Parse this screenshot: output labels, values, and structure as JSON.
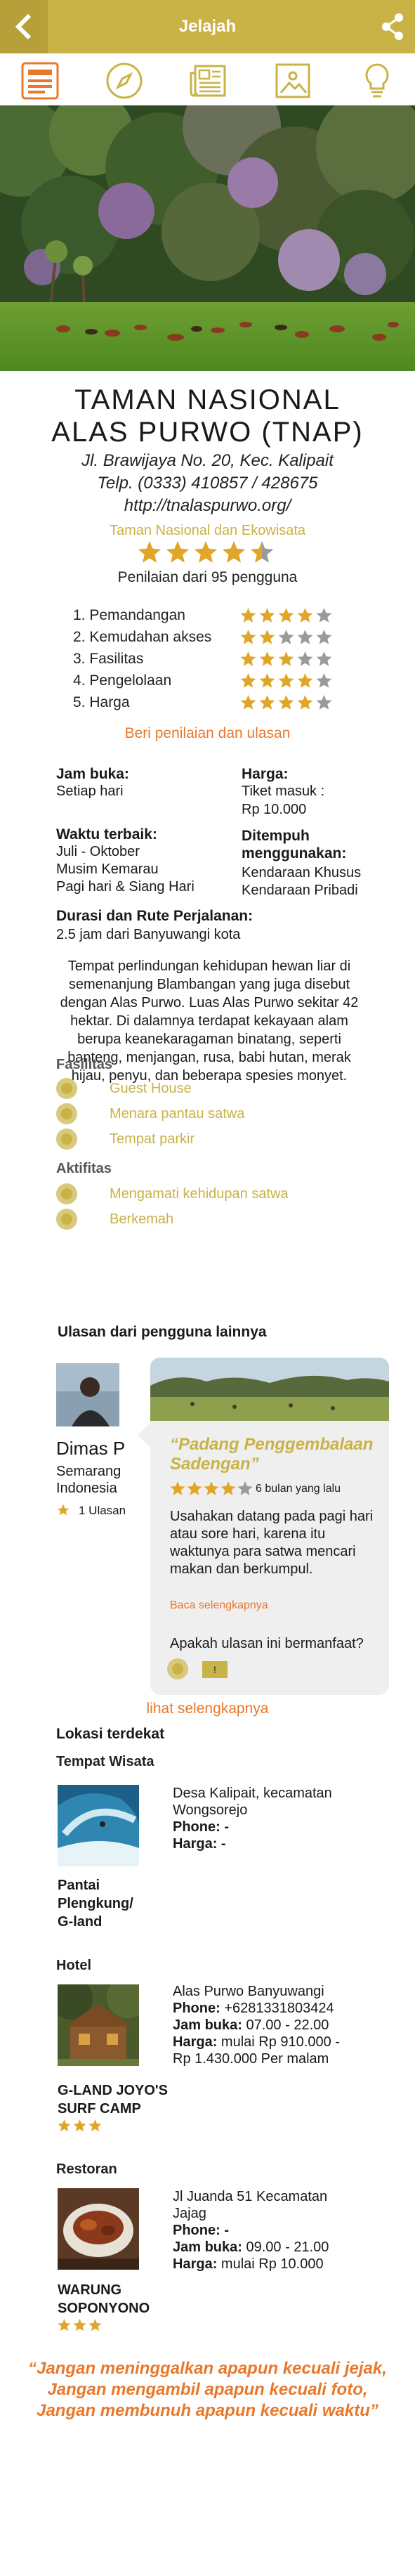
{
  "app": {
    "title": "Jelajah",
    "accent_color": "#c9b246",
    "link_color": "#e8782c"
  },
  "tabs": [
    {
      "icon": "document-icon"
    },
    {
      "icon": "compass-icon"
    },
    {
      "icon": "newspaper-icon"
    },
    {
      "icon": "image-icon"
    },
    {
      "icon": "lightbulb-icon"
    }
  ],
  "place": {
    "name_line1": "TAMAN NASIONAL",
    "name_line2": "ALAS PURWO (TNAP)",
    "address": "Jl. Brawijaya No. 20, Kec. Kalipait",
    "phone": "Telp. (0333) 410857 / 428675",
    "website": "http://tnalaspurwo.org/",
    "category": "Taman Nasional dan Ekowisata",
    "rating": 4.5,
    "rating_count_text": "Penilaian dari 95 pengguna"
  },
  "criteria": [
    {
      "label": "1. Pemandangan",
      "stars": 4
    },
    {
      "label": "2. Kemudahan akses",
      "stars": 2
    },
    {
      "label": "3. Fasilitas",
      "stars": 3
    },
    {
      "label": "4. Pengelolaan",
      "stars": 4
    },
    {
      "label": "5. Harga",
      "stars": 4
    }
  ],
  "rate_link": "Beri penilaian dan ulasan",
  "info": {
    "hours_label": "Jam buka:",
    "hours_value": "Setiap hari",
    "price_label": "Harga:",
    "price_value1": "Tiket masuk :",
    "price_value2": "Rp 10.000",
    "best_time_label": "Waktu terbaik:",
    "best_time_1": "Juli - Oktober",
    "best_time_2": "Musim Kemarau",
    "best_time_3": "Pagi hari & Siang Hari",
    "reach_label_1": "Ditempuh",
    "reach_label_2": "menggunakan:",
    "reach_1": "Kendaraan Khusus",
    "reach_2": "Kendaraan Pribadi",
    "route_label": "Durasi dan Rute Perjalanan:",
    "route_value": "2.5 jam dari Banyuwangi kota"
  },
  "description": "Tempat perlindungan kehidupan hewan liar di semenanjung Blambangan yang juga disebut dengan Alas Purwo. Luas Alas Purwo sekitar 42 hektar. Di dalamnya terdapat kekayaan alam berupa keanekaragaman binatang, seperti banteng, menjangan, rusa, babi hutan, merak hijau, penyu, dan beberapa spesies monyet.",
  "facilities": {
    "heading": "Fasilitas",
    "items": [
      "Guest House",
      "Menara pantau satwa",
      "Tempat parkir"
    ]
  },
  "activities": {
    "heading": "Aktifitas",
    "items": [
      "Mengamati kehidupan satwa",
      "Berkemah"
    ]
  },
  "reviews": {
    "heading": "Ulasan dari pengguna lainnya",
    "reviewer": {
      "name": "Dimas P",
      "location_1": "Semarang",
      "location_2": "Indonesia",
      "count": "1 Ulasan"
    },
    "card": {
      "title_1": "“Padang Penggembalaan",
      "title_2": "Sadengan”",
      "stars": 4,
      "time": "6 bulan yang lalu",
      "body": "Usahakan datang pada pagi hari atau sore hari, karena itu waktunya para satwa mencari makan dan berkumpul.",
      "more": "Baca selengkapnya",
      "question": "Apakah ulasan ini bermanfaat?",
      "yes_button": "!"
    },
    "see_more": "lihat selengkapnya"
  },
  "nearby": {
    "heading": "Lokasi terdekat",
    "sections": {
      "wisata": "Tempat Wisata",
      "hotel": "Hotel",
      "restoran": "Restoran"
    },
    "wisata": {
      "name_1": "Pantai",
      "name_2": "Plengkung/",
      "name_3": "G-land",
      "addr_1": "Desa Kalipait, kecamatan",
      "addr_2": "Wongsorejo",
      "phone": "Phone: -",
      "price": "Harga: -"
    },
    "hotel": {
      "name_1": "G-LAND JOYO'S",
      "name_2": "SURF CAMP",
      "stars": 3,
      "addr": "Alas Purwo Banyuwangi",
      "phone_label": "Phone:",
      "phone": "+6281331803424",
      "hours_label": "Jam buka:",
      "hours": "07.00 - 22.00",
      "price_label": "Harga:",
      "price_1": "mulai Rp 910.000 -",
      "price_2": "Rp 1.430.000 Per malam"
    },
    "restoran": {
      "name_1": "WARUNG",
      "name_2": "SOPONYONO",
      "stars": 3,
      "addr_1": "Jl Juanda 51 Kecamatan",
      "addr_2": "Jajag",
      "phone": "Phone: -",
      "hours_label": "Jam buka:",
      "hours": "09.00 - 21.00",
      "price_label": "Harga:",
      "price": "mulai Rp 10.000"
    }
  },
  "quote": {
    "line_1": "“Jangan meninggalkan apapun kecuali jejak,",
    "line_2": "Jangan mengambil apapun kecuali foto,",
    "line_3": "Jangan membunuh apapun kecuali waktu”"
  }
}
